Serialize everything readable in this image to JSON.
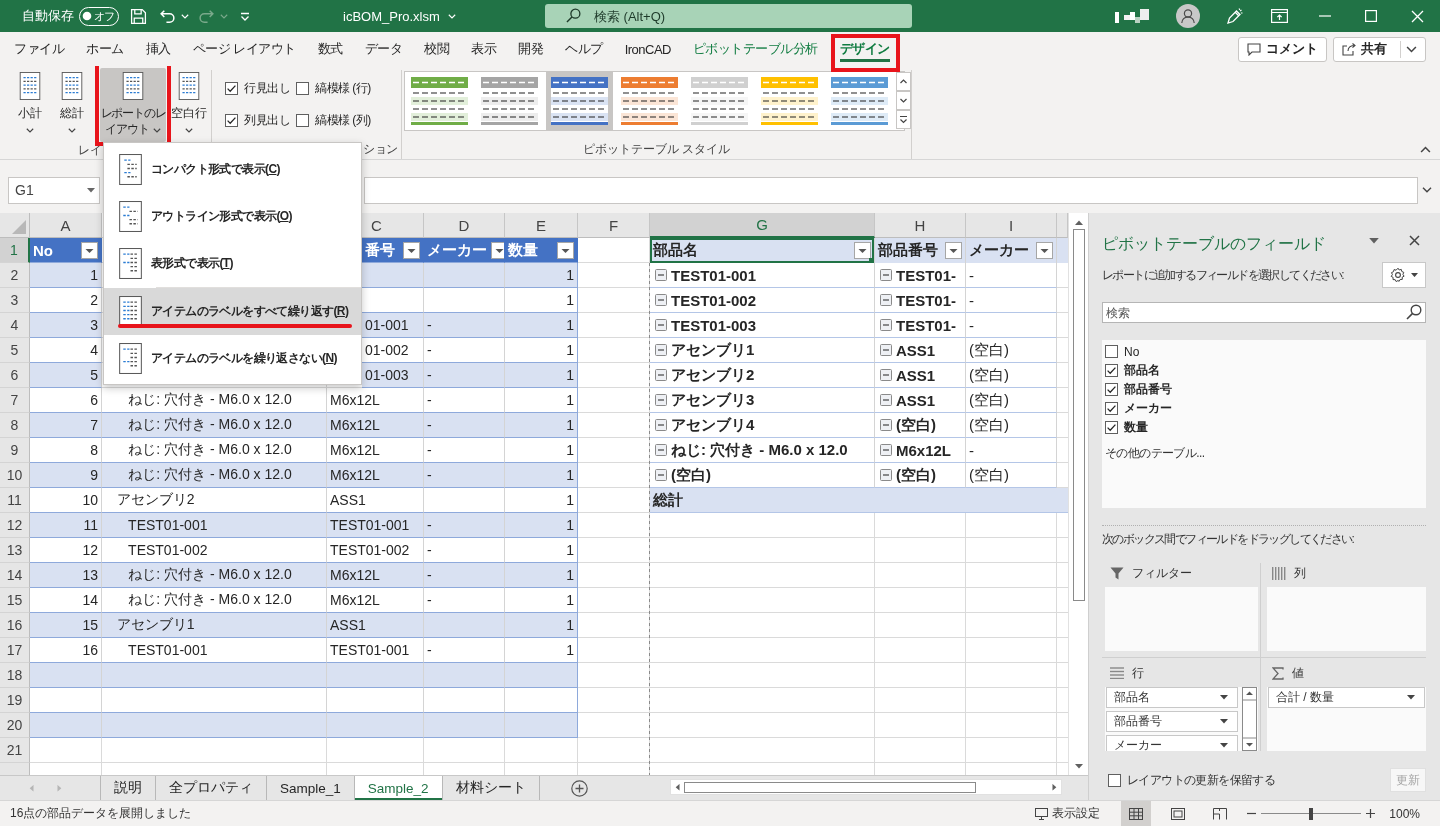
{
  "title_bar": {
    "autosave": {
      "label": "自動保存",
      "state_label": "オフ",
      "on": false
    },
    "quick_access": [
      {
        "kind": "save",
        "disabled": false
      },
      {
        "kind": "undo",
        "disabled": false
      },
      {
        "kind": "redo",
        "disabled": true
      },
      {
        "kind": "customize",
        "disabled": false
      }
    ],
    "file_name": "icBOM_Pro.xlsm",
    "search": {
      "placeholder": "検索 (Alt+Q)"
    }
  },
  "ribbon": {
    "tabs": [
      {
        "label": "ファイル",
        "selected": false,
        "contextual": false,
        "highlighted": false
      },
      {
        "label": "ホーム",
        "selected": false,
        "contextual": false,
        "highlighted": false
      },
      {
        "label": "挿入",
        "selected": false,
        "contextual": false,
        "highlighted": false
      },
      {
        "label": "ページ レイアウト",
        "selected": false,
        "contextual": false,
        "highlighted": false
      },
      {
        "label": "数式",
        "selected": false,
        "contextual": false,
        "highlighted": false
      },
      {
        "label": "データ",
        "selected": false,
        "contextual": false,
        "highlighted": false
      },
      {
        "label": "校閲",
        "selected": false,
        "contextual": false,
        "highlighted": false
      },
      {
        "label": "表示",
        "selected": false,
        "contextual": false,
        "highlighted": false
      },
      {
        "label": "開発",
        "selected": false,
        "contextual": false,
        "highlighted": false
      },
      {
        "label": "ヘルプ",
        "selected": false,
        "contextual": false,
        "highlighted": false
      },
      {
        "label": "IronCAD",
        "selected": false,
        "contextual": false,
        "highlighted": false
      },
      {
        "label": "ピボットテーブル分析",
        "selected": false,
        "contextual": true,
        "highlighted": false
      },
      {
        "label": "デザイン",
        "selected": true,
        "contextual": true,
        "highlighted": true
      }
    ],
    "actions": [
      {
        "kind": "comment",
        "label": "コメント"
      },
      {
        "kind": "share",
        "label": "共有"
      }
    ],
    "layout_group": {
      "label": "レイ",
      "buttons": [
        {
          "label": "小計",
          "pressed": false,
          "highlighted": false
        },
        {
          "label": "総計",
          "pressed": false,
          "highlighted": false
        },
        {
          "label": "レポートのレイアウト",
          "pressed": true,
          "highlighted": true
        },
        {
          "label": "空白行",
          "pressed": false,
          "highlighted": false
        }
      ]
    },
    "options_group": {
      "label": "ション",
      "checkboxes": [
        {
          "label": "行見出し",
          "checked": true
        },
        {
          "label": "縞模様 (行)",
          "checked": false
        },
        {
          "label": "列見出し",
          "checked": true
        },
        {
          "label": "縞模様 (列)",
          "checked": false
        }
      ]
    },
    "styles_group": {
      "label": "ピボットテーブル スタイル",
      "styles": [
        {
          "color": "#70ad47",
          "selected": false
        },
        {
          "color": "#a5a5a5",
          "selected": false
        },
        {
          "color": "#4472c4",
          "selected": true
        },
        {
          "color": "#ed7d31",
          "selected": false
        },
        {
          "color": "#d0d0d0",
          "selected": false
        },
        {
          "color": "#ffc000",
          "selected": false
        },
        {
          "color": "#5b9bd5",
          "selected": false
        }
      ]
    }
  },
  "layout_menu": {
    "open": true,
    "items": [
      {
        "kind": "compact",
        "label": "コンパクト形式で表示(",
        "access_key": "C",
        "label_end": ")",
        "selected": false,
        "highlighted": false
      },
      {
        "kind": "outline",
        "label": "アウトライン形式で表示(",
        "access_key": "O",
        "label_end": ")",
        "selected": false,
        "highlighted": false
      },
      {
        "kind": "tabular",
        "label": "表形式で表示(",
        "access_key": "T",
        "label_end": ")",
        "selected": false,
        "highlighted": false
      },
      {
        "kind": "repeat",
        "label": "アイテムのラベルをすべて繰り返す(",
        "access_key": "R",
        "label_end": ")",
        "selected": true,
        "highlighted": true
      },
      {
        "kind": "no_repeat",
        "label": "アイテムのラベルを繰り返さない(",
        "access_key": "N",
        "label_end": ")",
        "selected": false,
        "highlighted": false
      }
    ]
  },
  "formula_bar": {
    "name_box": "G1"
  },
  "sheet": {
    "columns": [
      {
        "letter": "A",
        "selected": false
      },
      {
        "letter": "C",
        "selected": false
      },
      {
        "letter": "D",
        "selected": false
      },
      {
        "letter": "E",
        "selected": false
      },
      {
        "letter": "F",
        "selected": false
      },
      {
        "letter": "G",
        "selected": true
      },
      {
        "letter": "H",
        "selected": false
      },
      {
        "letter": "I",
        "selected": false
      }
    ],
    "row_numbers": [
      {
        "label": "1",
        "selected": true
      },
      {
        "label": "2",
        "selected": false
      },
      {
        "label": "3",
        "selected": false
      },
      {
        "label": "4",
        "selected": false
      },
      {
        "label": "5",
        "selected": false
      },
      {
        "label": "6",
        "selected": false
      },
      {
        "label": "7",
        "selected": false
      },
      {
        "label": "8",
        "selected": false
      },
      {
        "label": "9",
        "selected": false
      },
      {
        "label": "10",
        "selected": false
      },
      {
        "label": "11",
        "selected": false
      },
      {
        "label": "12",
        "selected": false
      },
      {
        "label": "13",
        "selected": false
      },
      {
        "label": "14",
        "selected": false
      },
      {
        "label": "15",
        "selected": false
      },
      {
        "label": "16",
        "selected": false
      },
      {
        "label": "17",
        "selected": false
      },
      {
        "label": "18",
        "selected": false
      },
      {
        "label": "19",
        "selected": false
      },
      {
        "label": "20",
        "selected": false
      },
      {
        "label": "21",
        "selected": false
      }
    ],
    "table": {
      "header": {
        "no": "No",
        "part_no": "番号",
        "maker": "メーカー",
        "qty": "数量"
      },
      "rows": [
        {
          "no": "1",
          "qty": "1"
        },
        {
          "no": "2",
          "qty": "1"
        },
        {
          "no": "3",
          "part_no": "01-001",
          "maker": "-",
          "qty": "1"
        },
        {
          "no": "4",
          "part_no": "01-002",
          "maker": "-",
          "qty": "1"
        },
        {
          "no": "5",
          "part_no": "01-003",
          "maker": "-",
          "qty": "1"
        },
        {
          "no": "6",
          "name": "      ねじ: 穴付き - M6.0 x 12.0",
          "part_no": "M6x12L",
          "maker": "-",
          "qty": "1"
        },
        {
          "no": "7",
          "name": "      ねじ: 穴付き - M6.0 x 12.0",
          "part_no": "M6x12L",
          "maker": "-",
          "qty": "1"
        },
        {
          "no": "8",
          "name": "      ねじ: 穴付き - M6.0 x 12.0",
          "part_no": "M6x12L",
          "maker": "-",
          "qty": "1"
        },
        {
          "no": "9",
          "name": "      ねじ: 穴付き - M6.0 x 12.0",
          "part_no": "M6x12L",
          "maker": "-",
          "qty": "1"
        },
        {
          "no": "10",
          "name": "   アセンブリ2",
          "part_no": "ASS1",
          "qty": "1"
        },
        {
          "no": "11",
          "name": "      TEST01-001",
          "part_no": "TEST01-001",
          "maker": "-",
          "qty": "1"
        },
        {
          "no": "12",
          "name": "      TEST01-002",
          "part_no": "TEST01-002",
          "maker": "-",
          "qty": "1"
        },
        {
          "no": "13",
          "name": "      ねじ: 穴付き - M6.0 x 12.0",
          "part_no": "M6x12L",
          "maker": "-",
          "qty": "1"
        },
        {
          "no": "14",
          "name": "      ねじ: 穴付き - M6.0 x 12.0",
          "part_no": "M6x12L",
          "maker": "-",
          "qty": "1"
        },
        {
          "no": "15",
          "name": "   アセンブリ1",
          "part_no": "ASS1",
          "qty": "1"
        },
        {
          "no": "16",
          "name": "      TEST01-001",
          "part_no": "TEST01-001",
          "maker": "-",
          "qty": "1"
        }
      ]
    },
    "pivot": {
      "header": [
        {
          "label": "部品名",
          "selected": true
        },
        {
          "label": "部品番号",
          "selected": false
        },
        {
          "label": "メーカー",
          "selected": false
        }
      ],
      "rows": [
        {
          "name": {
            "label": "TEST01-001",
            "expanded": true
          },
          "part_no": {
            "label": "TEST01-",
            "expanded": true
          },
          "maker": "-"
        },
        {
          "name": {
            "label": "TEST01-002",
            "expanded": true
          },
          "part_no": {
            "label": "TEST01-",
            "expanded": true
          },
          "maker": "-"
        },
        {
          "name": {
            "label": "TEST01-003",
            "expanded": true
          },
          "part_no": {
            "label": "TEST01-",
            "expanded": true
          },
          "maker": "-"
        },
        {
          "name": {
            "label": "アセンブリ1",
            "expanded": true
          },
          "part_no": {
            "label": "ASS1",
            "expanded": true
          },
          "maker": "(空白)"
        },
        {
          "name": {
            "label": "アセンブリ2",
            "expanded": true
          },
          "part_no": {
            "label": "ASS1",
            "expanded": true
          },
          "maker": "(空白)"
        },
        {
          "name": {
            "label": "アセンブリ3",
            "expanded": true
          },
          "part_no": {
            "label": "ASS1",
            "expanded": true
          },
          "maker": "(空白)"
        },
        {
          "name": {
            "label": "アセンブリ4",
            "expanded": true
          },
          "part_no": {
            "label": "(空白)",
            "expanded": true
          },
          "maker": "(空白)"
        },
        {
          "name": {
            "label": "ねじ: 穴付き - M6.0 x 12.0",
            "expanded": true
          },
          "part_no": {
            "label": "M6x12L",
            "expanded": true
          },
          "maker": "-"
        },
        {
          "name": {
            "label": "(空白)",
            "expanded": true
          },
          "part_no": {
            "label": "(空白)",
            "expanded": true
          },
          "maker": "(空白)"
        }
      ],
      "grand_total": "総計"
    }
  },
  "sheet_tabs": [
    {
      "label": "説明",
      "selected": false
    },
    {
      "label": "全プロパティ",
      "selected": false
    },
    {
      "label": "Sample_1",
      "selected": false
    },
    {
      "label": "Sample_2",
      "selected": true
    },
    {
      "label": "材料シート",
      "selected": false
    }
  ],
  "field_pane": {
    "title": "ピボットテーブルのフィールド",
    "instruction": "レポートに追加するフィールドを選択してください:",
    "search": {
      "placeholder": "検索"
    },
    "fields": [
      {
        "label": "No",
        "checked": false
      },
      {
        "label": "部品名",
        "checked": true
      },
      {
        "label": "部品番号",
        "checked": true
      },
      {
        "label": "メーカー",
        "checked": true
      },
      {
        "label": "数量",
        "checked": true
      }
    ],
    "more_tables": "その他のテーブル...",
    "drag_hint": "次のボックス間でフィールドをドラッグしてください:",
    "areas": [
      {
        "kind": "filters",
        "label": "フィルター"
      },
      {
        "kind": "columns",
        "label": "列"
      },
      {
        "kind": "rows",
        "label": "行",
        "items": [
          "部品名",
          "部品番号",
          "メーカー"
        ]
      },
      {
        "kind": "values",
        "label": "値",
        "items": [
          "合計 / 数量"
        ]
      }
    ],
    "defer_update": {
      "label": "レイアウトの更新を保留する",
      "checked": false
    },
    "update_button": {
      "label": "更新",
      "disabled": true
    }
  },
  "status_bar": {
    "message": "16点の部品データを展開しました",
    "display_settings": "表示設定",
    "views": [
      {
        "kind": "normal",
        "selected": true
      },
      {
        "kind": "page_layout",
        "selected": false
      },
      {
        "kind": "page_break",
        "selected": false
      }
    ],
    "zoom": {
      "level": 0.5,
      "label": "100%"
    }
  }
}
